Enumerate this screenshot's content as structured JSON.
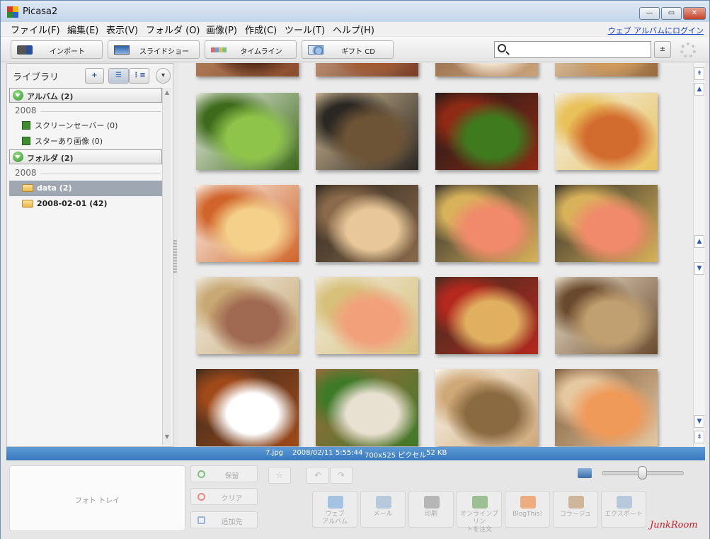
{
  "window": {
    "title": "Picasa2"
  },
  "menu": {
    "items": [
      "ファイル(F)",
      "編集(E)",
      "表示(V)",
      "フォルダ (O)",
      "画像(P)",
      "作成(C)",
      "ツール(T)",
      "ヘルプ(H)"
    ],
    "login_link": "ウェブ アルバムにログイン"
  },
  "toolbar": {
    "buttons": [
      {
        "label": "インポート",
        "icon": "import-camera-icon"
      },
      {
        "label": "スライドショー",
        "icon": "slideshow-icon"
      },
      {
        "label": "タイムライン",
        "icon": "timeline-icon"
      },
      {
        "label": "ギフト CD",
        "icon": "gift-cd-icon"
      }
    ],
    "search_value": "",
    "search_placeholder": "",
    "search_options_glyph": "±"
  },
  "library": {
    "title": "ライブラリ",
    "add_album_label": "+",
    "albums_header": "アルバム (2)",
    "albums_year": "2008",
    "albums": [
      "スクリーンセーバー (0)",
      "スターあり画像 (0)"
    ],
    "folders_header": "フォルダ (2)",
    "folders_year": "2008",
    "folders": [
      {
        "label": "data (2)",
        "selected": true
      },
      {
        "label": "2008-02-01 (42)",
        "selected": false
      }
    ]
  },
  "grid": {
    "photos": [
      {
        "colors": [
          "#8a4a2c",
          "#5a2e1a",
          "#c0946a"
        ]
      },
      {
        "colors": [
          "#7a3c22",
          "#a25a32",
          "#d8b89a"
        ]
      },
      {
        "colors": [
          "#caa27a",
          "#f0e2cc",
          "#8a6040"
        ]
      },
      {
        "colors": [
          "#9a6a3a",
          "#d09a5a",
          "#f3e0c0"
        ]
      },
      {
        "colors": [
          "#3e6a1c",
          "#8ec44a",
          "#eef1e8"
        ]
      },
      {
        "colors": [
          "#2b2722",
          "#6e5436",
          "#d3bc96"
        ]
      },
      {
        "colors": [
          "#8e2a16",
          "#3f7a1f",
          "#1b1a18"
        ]
      },
      {
        "colors": [
          "#e9c15a",
          "#d26b2e",
          "#f3f3f0"
        ]
      },
      {
        "colors": [
          "#d0642a",
          "#f4d08a",
          "#fbf6ee"
        ]
      },
      {
        "colors": [
          "#8a6a4a",
          "#e8c89a",
          "#2c2620"
        ]
      },
      {
        "colors": [
          "#d8b25a",
          "#f08a6a",
          "#2b2b2b"
        ]
      },
      {
        "colors": [
          "#d8b25a",
          "#f08a6a",
          "#2e2c28"
        ]
      },
      {
        "colors": [
          "#c8a874",
          "#a06a52",
          "#f2efe6"
        ]
      },
      {
        "colors": [
          "#d7c07a",
          "#f2a07a",
          "#f1ecdf"
        ]
      },
      {
        "colors": [
          "#b4281e",
          "#e0b060",
          "#3a2e20"
        ]
      },
      {
        "colors": [
          "#6a4a2e",
          "#c0a070",
          "#f0e6d0"
        ]
      },
      {
        "colors": [
          "#a04a1a",
          "#ffffff",
          "#3a2a1e"
        ]
      },
      {
        "colors": [
          "#3f7a28",
          "#e8e0d0",
          "#a06a40"
        ]
      },
      {
        "colors": [
          "#cfa878",
          "#8a6a40",
          "#fbf8f0"
        ]
      },
      {
        "colors": [
          "#e6c8a0",
          "#f09a5a",
          "#7a5838"
        ]
      }
    ]
  },
  "status": {
    "filename": "7.jpg",
    "datetime": "2008/02/11 5:55:44",
    "dimensions": "700x525 ピクセル",
    "size": "52 KB"
  },
  "tray": {
    "label": "フォト トレイ",
    "hold_label": "保留",
    "clear_label": "クリア",
    "add_to_label": "追加先"
  },
  "actions": [
    {
      "label": "ウェブ\nアルバム",
      "icon": "web-album-icon",
      "color": "#6aa0d8"
    },
    {
      "label": "メール",
      "icon": "mail-icon",
      "color": "#8aaed0"
    },
    {
      "label": "印刷",
      "icon": "print-icon",
      "color": "#8a8a8a"
    },
    {
      "label": "オンラインプリン\nトを注文",
      "icon": "online-print-icon",
      "color": "#5c9a4c"
    },
    {
      "label": "BlogThis!",
      "icon": "blogger-icon",
      "color": "#f07a2a"
    },
    {
      "label": "コラージュ",
      "icon": "collage-icon",
      "color": "#b88a5a"
    },
    {
      "label": "エクスポート",
      "icon": "export-icon",
      "color": "#8aaed0"
    }
  ],
  "watermark": "JunkRoom"
}
